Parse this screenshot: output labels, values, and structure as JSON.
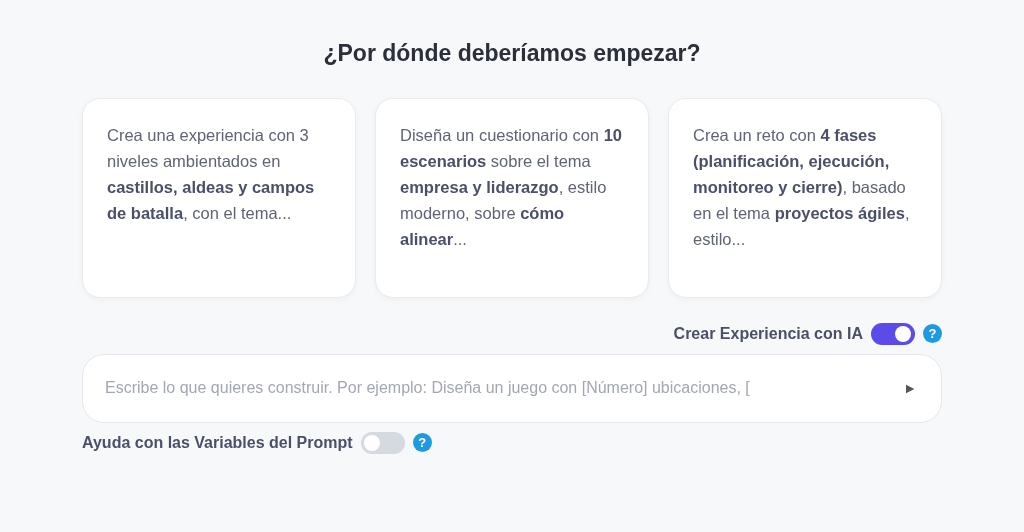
{
  "title": "¿Por dónde deberíamos empezar?",
  "suggestions": [
    {
      "text": "Crea una experiencia con 3 niveles ambientados en **castillos, aldeas y campos de batalla**, con el tema..."
    },
    {
      "text": "Diseña un cuestionario con **10 escenarios** sobre el tema **empresa y liderazgo**, estilo moderno, sobre **cómo alinear**..."
    },
    {
      "text": "Crea un reto con **4 fases (planificación, ejecución, monitoreo y cierre)**, basado en el tema **proyectos ágiles**, estilo..."
    }
  ],
  "ai_toggle": {
    "label": "Crear Experiencia con IA",
    "on": true,
    "help": "?"
  },
  "prompt": {
    "placeholder": "Escribe lo que quieres construir. Por ejemplo: Diseña un juego con [Número] ubicaciones, [",
    "send": "►"
  },
  "variables_toggle": {
    "label": "Ayuda con las Variables del Prompt",
    "on": false,
    "help": "?"
  }
}
